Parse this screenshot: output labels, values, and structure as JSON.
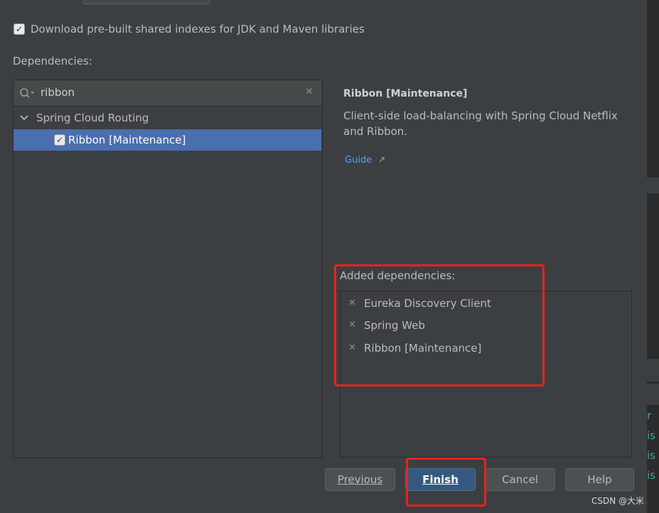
{
  "download_indexes": {
    "label": "Download pre-built shared indexes for JDK and Maven libraries",
    "checked": true
  },
  "dependencies_label": "Dependencies:",
  "search": {
    "value": "ribbon"
  },
  "tree": {
    "group": "Spring Cloud Routing",
    "item": "Ribbon [Maintenance]"
  },
  "details": {
    "title": "Ribbon [Maintenance]",
    "description_line1": "Client-side load-balancing with Spring Cloud Netflix",
    "description_line2": "and Ribbon.",
    "guide": "Guide",
    "guide_arrow": "↗"
  },
  "added": {
    "label": "Added dependencies:",
    "items": [
      "Eureka Discovery Client",
      "Spring Web",
      "Ribbon [Maintenance]"
    ]
  },
  "buttons": {
    "previous": "Previous",
    "finish": "Finish",
    "cancel": "Cancel",
    "help": "Help"
  },
  "side_code": [
    "r",
    "is",
    "is",
    "is"
  ],
  "watermark": "CSDN @大米",
  "colors": {
    "selection": "#4b6eaf",
    "link": "#589df6",
    "annotation": "#e52420",
    "primary": "#365880"
  }
}
